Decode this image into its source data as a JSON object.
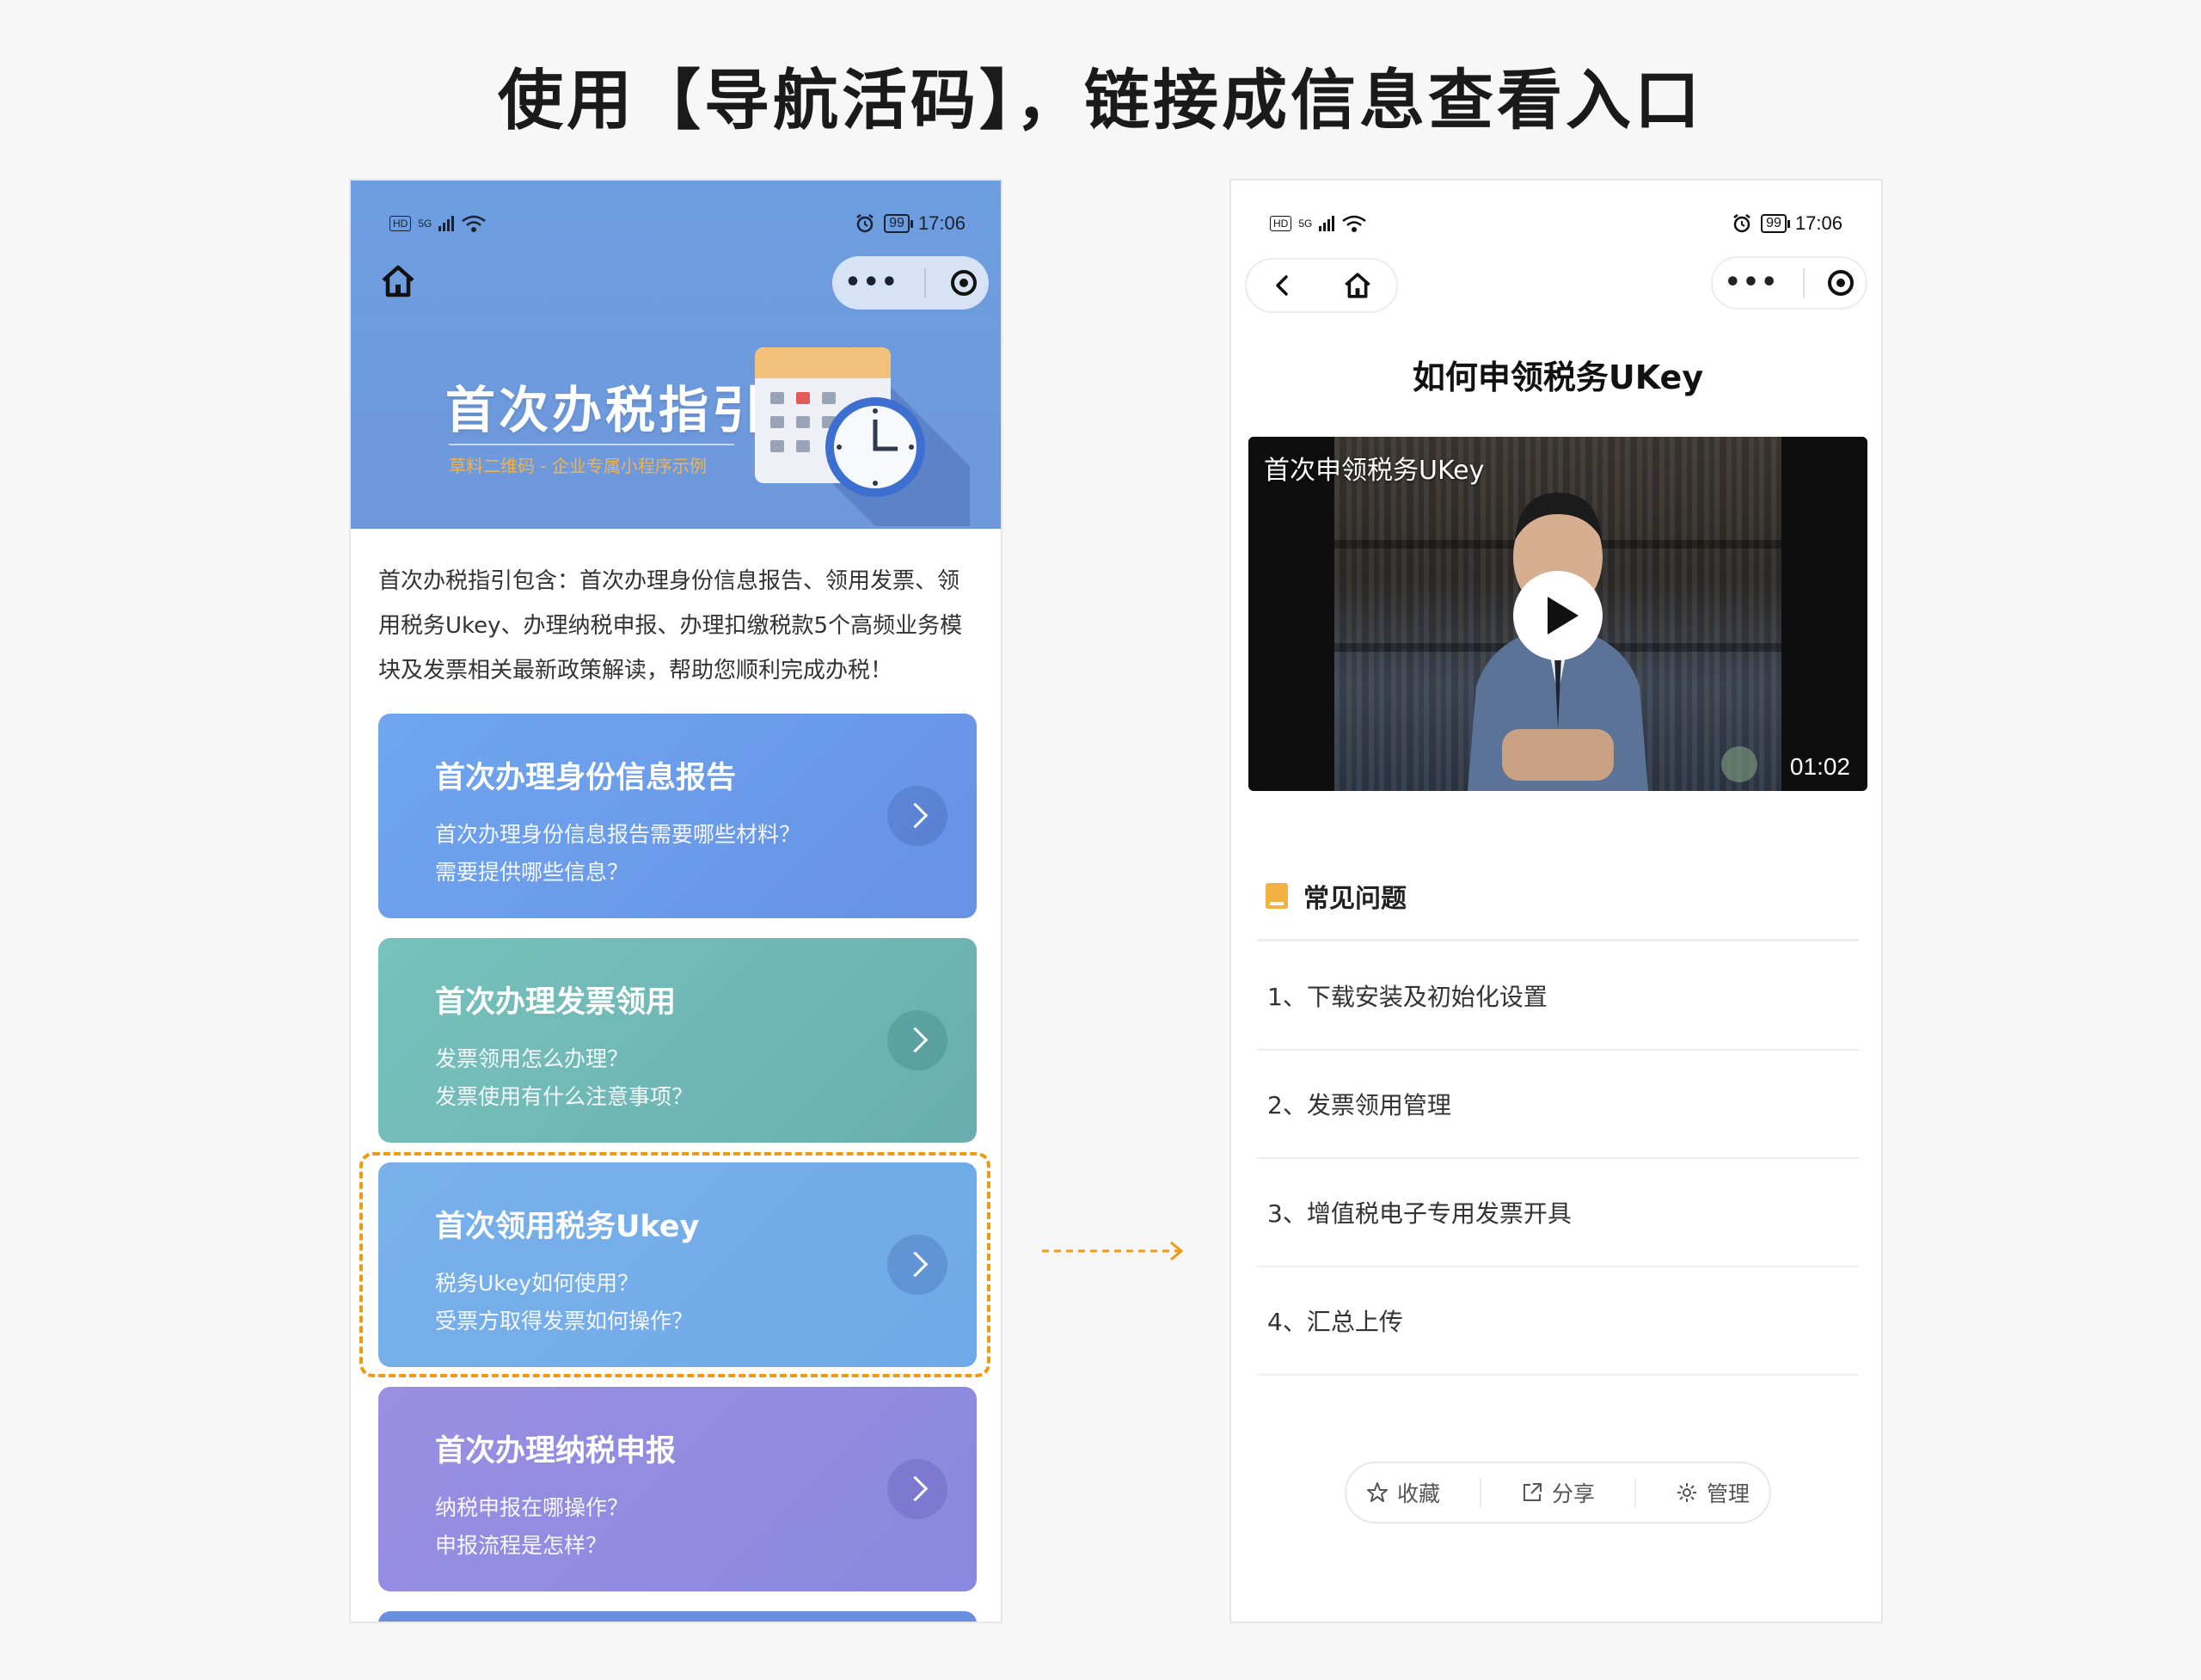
{
  "headline": "使用【导航活码】，链接成信息查看入口",
  "status": {
    "hd": "HD",
    "net": "5G",
    "net2": "6",
    "battery": "99",
    "time": "17:06"
  },
  "left": {
    "banner_title": "首次办税指引",
    "banner_sub": "草料二维码 - 企业专属小程序示例",
    "intro": "首次办税指引包含：首次办理身份信息报告、领用发票、领用税务Ukey、办理纳税申报、办理扣缴税款5个高频业务模块及发票相关最新政策解读，帮助您顺利完成办税！",
    "cards": [
      {
        "title": "首次办理身份信息报告",
        "line1": "首次办理身份信息报告需要哪些材料？",
        "line2": "需要提供哪些信息？"
      },
      {
        "title": "首次办理发票领用",
        "line1": "发票领用怎么办理？",
        "line2": "发票使用有什么注意事项？"
      },
      {
        "title": "首次领用税务Ukey",
        "line1": "税务Ukey如何使用？",
        "line2": "受票方取得发票如何操作？"
      },
      {
        "title": "首次办理纳税申报",
        "line1": "纳税申报在哪操作？",
        "line2": "申报流程是怎样？"
      }
    ]
  },
  "right": {
    "page_title": "如何申领税务UKey",
    "video": {
      "title": "首次申领税务UKey",
      "duration": "01:02"
    },
    "faq_title": "常见问题",
    "faq": [
      "1、下载安装及初始化设置",
      "2、发票领用管理",
      "3、增值税电子专用发票开具",
      "4、汇总上传"
    ],
    "actions": {
      "favorite": "收藏",
      "share": "分享",
      "manage": "管理"
    }
  },
  "colors": {
    "highlight": "#f09a12",
    "accent_blue": "#6e98dc",
    "book_icon": "#f2b241"
  }
}
